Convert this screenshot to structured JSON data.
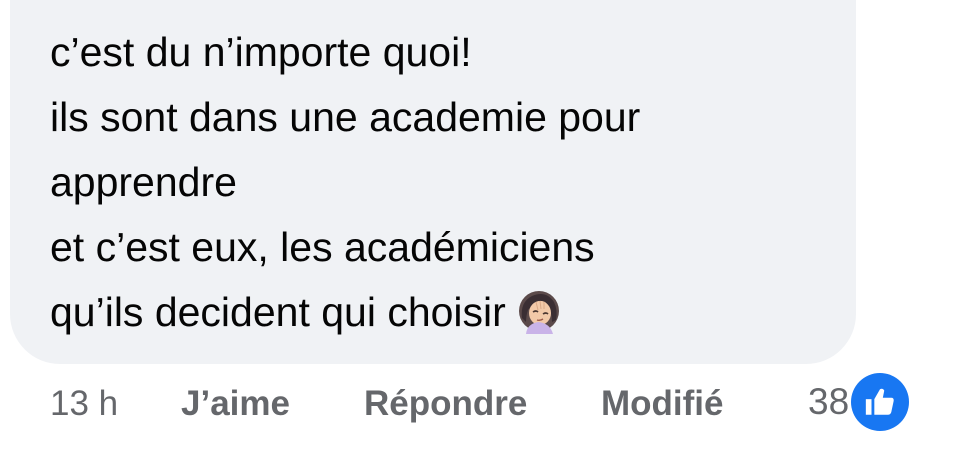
{
  "comment": {
    "lines": [
      "c’est du n’importe quoi!",
      "ils sont dans une academie pour",
      "apprendre",
      "et c’est eux, les académiciens",
      "qu’ils decident qui choisir"
    ],
    "trailing_emoji": "face-palm-emoji"
  },
  "actions": {
    "time": "13 h",
    "like": "J’aime",
    "reply": "Répondre",
    "edited": "Modifié"
  },
  "reactions": {
    "count": "38",
    "type": "like-icon",
    "color": "#1877f2"
  },
  "colors": {
    "bubble": "#f0f2f5",
    "text": "#050505",
    "meta": "#65676b"
  }
}
